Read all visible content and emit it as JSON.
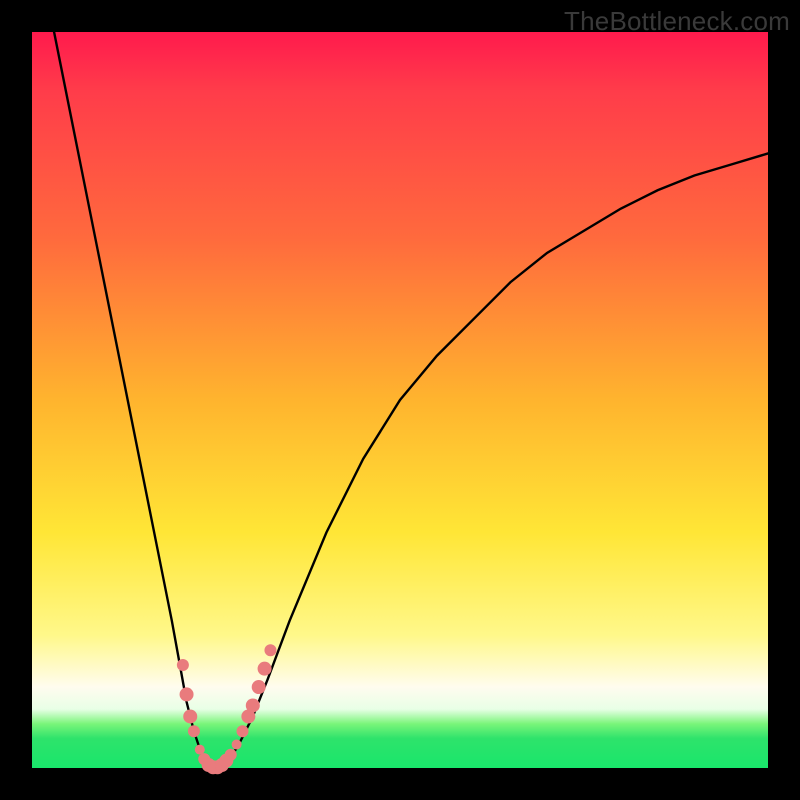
{
  "attribution": "TheBottleneck.com",
  "colors": {
    "frame": "#000000",
    "curve": "#000000",
    "marker": "#e97b7d",
    "gradient_stops": [
      "#ff1a4d",
      "#ff3c4a",
      "#ff6a3d",
      "#ffb42e",
      "#ffe636",
      "#fff88a",
      "#fffcef",
      "#e8ffe6",
      "#7af57a",
      "#2ee36b",
      "#19e66b"
    ]
  },
  "chart_data": {
    "type": "line",
    "title": "",
    "xlabel": "",
    "ylabel": "",
    "xlim": [
      0,
      100
    ],
    "ylim": [
      0,
      100
    ],
    "series": [
      {
        "name": "left-branch",
        "x": [
          3,
          5,
          7,
          9,
          11,
          13,
          15,
          17,
          19,
          21,
          22,
          23,
          24,
          25
        ],
        "y": [
          100,
          90,
          80,
          70,
          60,
          50,
          40,
          30,
          20,
          9,
          5,
          2,
          0.5,
          0
        ]
      },
      {
        "name": "right-branch",
        "x": [
          25,
          26,
          27,
          28,
          30,
          32,
          35,
          40,
          45,
          50,
          55,
          60,
          65,
          70,
          75,
          80,
          85,
          90,
          95,
          100
        ],
        "y": [
          0,
          0.5,
          1.5,
          3,
          7,
          12,
          20,
          32,
          42,
          50,
          56,
          61,
          66,
          70,
          73,
          76,
          78.5,
          80.5,
          82,
          83.5
        ]
      }
    ],
    "markers": {
      "name": "highlight-points",
      "color": "#e97b7d",
      "points": [
        {
          "x": 20.5,
          "y": 14,
          "r": 6
        },
        {
          "x": 21.0,
          "y": 10,
          "r": 7
        },
        {
          "x": 21.5,
          "y": 7,
          "r": 7
        },
        {
          "x": 22.0,
          "y": 5,
          "r": 6
        },
        {
          "x": 22.8,
          "y": 2.5,
          "r": 5
        },
        {
          "x": 23.4,
          "y": 1.2,
          "r": 6
        },
        {
          "x": 24.0,
          "y": 0.4,
          "r": 7
        },
        {
          "x": 24.6,
          "y": 0.1,
          "r": 7
        },
        {
          "x": 25.2,
          "y": 0.1,
          "r": 7
        },
        {
          "x": 25.8,
          "y": 0.4,
          "r": 7
        },
        {
          "x": 26.4,
          "y": 1.0,
          "r": 7
        },
        {
          "x": 27.0,
          "y": 1.8,
          "r": 6
        },
        {
          "x": 27.8,
          "y": 3.2,
          "r": 5
        },
        {
          "x": 28.6,
          "y": 5.0,
          "r": 6
        },
        {
          "x": 29.4,
          "y": 7.0,
          "r": 7
        },
        {
          "x": 30.0,
          "y": 8.5,
          "r": 7
        },
        {
          "x": 30.8,
          "y": 11.0,
          "r": 7
        },
        {
          "x": 31.6,
          "y": 13.5,
          "r": 7
        },
        {
          "x": 32.4,
          "y": 16.0,
          "r": 6
        }
      ]
    }
  }
}
